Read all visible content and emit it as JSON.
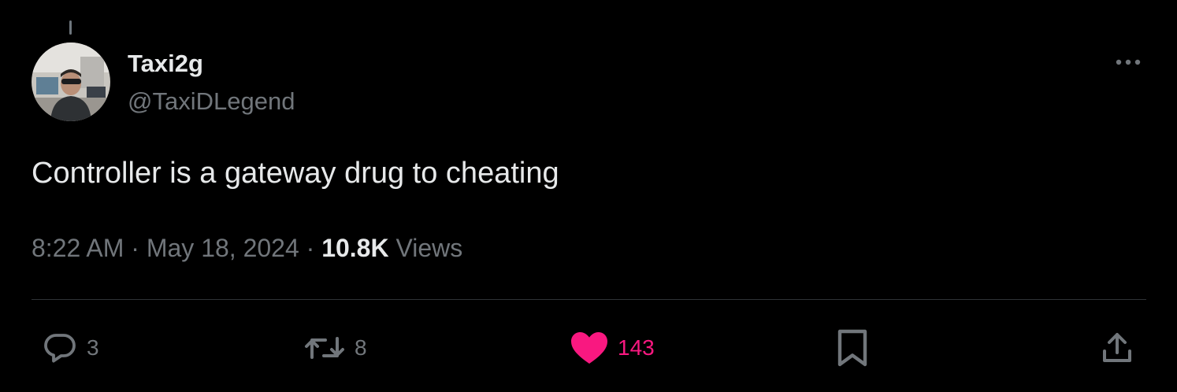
{
  "tweet": {
    "display_name": "Taxi2g",
    "handle": "@TaxiDLegend",
    "text": "Controller is a gateway drug to cheating",
    "time": "8:22 AM",
    "separator": " · ",
    "date": "May 18, 2024",
    "views_count": "10.8K",
    "views_label": " Views"
  },
  "actions": {
    "replies": "3",
    "reposts": "8",
    "likes": "143"
  },
  "colors": {
    "background": "#000000",
    "primary_text": "#e7e9ea",
    "secondary_text": "#71767b",
    "like_pink": "#f91880",
    "divider": "#2f3336"
  },
  "icons": [
    "more-icon",
    "reply-icon",
    "retweet-icon",
    "heart-icon",
    "bookmark-icon",
    "share-icon"
  ]
}
